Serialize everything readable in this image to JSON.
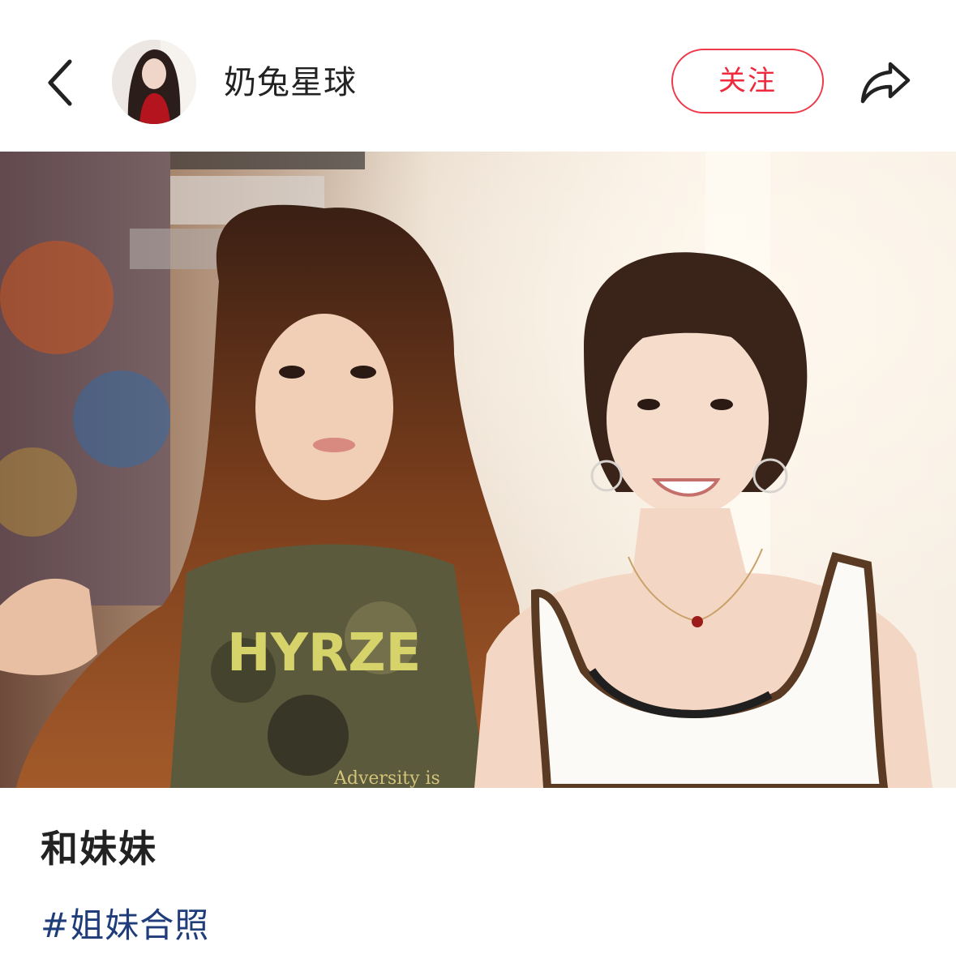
{
  "header": {
    "username": "奶兔星球",
    "follow_label": "关注"
  },
  "post": {
    "title": "和妹妹",
    "hashtag": "#姐妹合照",
    "shirt_text_left": "HYRZE",
    "shirt_text_bottom": "Adversity is"
  },
  "colors": {
    "accent_red": "#ee2a3c",
    "hashtag_blue": "#1f3d7a",
    "text_dark": "#222222"
  },
  "icons": {
    "back": "chevron-left-icon",
    "share": "share-arrow-icon"
  }
}
